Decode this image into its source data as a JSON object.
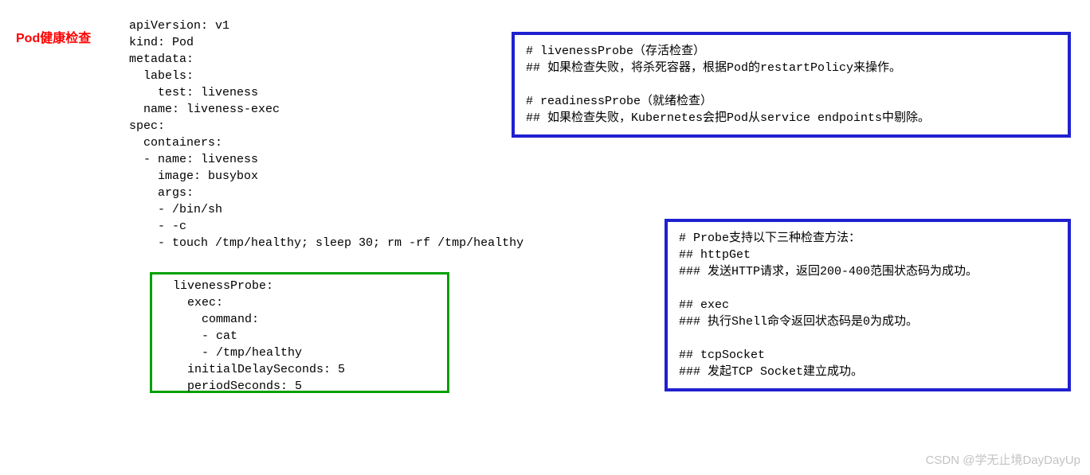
{
  "title": "Pod健康检查",
  "yaml_top": "apiVersion: v1\nkind: Pod\nmetadata:\n  labels:\n    test: liveness\n  name: liveness-exec\nspec:\n  containers:\n  - name: liveness\n    image: busybox\n    args:\n    - /bin/sh\n    - -c\n    - touch /tmp/healthy; sleep 30; rm -rf /tmp/healthy",
  "yaml_greenbox": "  livenessProbe:\n    exec:\n      command:\n      - cat\n      - /tmp/healthy\n    initialDelaySeconds: 5\n    periodSeconds: 5",
  "note_box_1": "# livenessProbe（存活检查）\n## 如果检查失败，将杀死容器，根据Pod的restartPolicy来操作。\n\n# readinessProbe（就绪检查）\n## 如果检查失败，Kubernetes会把Pod从service endpoints中剔除。",
  "note_box_2": "# Probe支持以下三种检查方法：\n## httpGet\n### 发送HTTP请求，返回200-400范围状态码为成功。\n\n## exec\n### 执行Shell命令返回状态码是0为成功。\n\n## tcpSocket\n### 发起TCP Socket建立成功。",
  "watermark": "CSDN @学无止境DayDayUp"
}
